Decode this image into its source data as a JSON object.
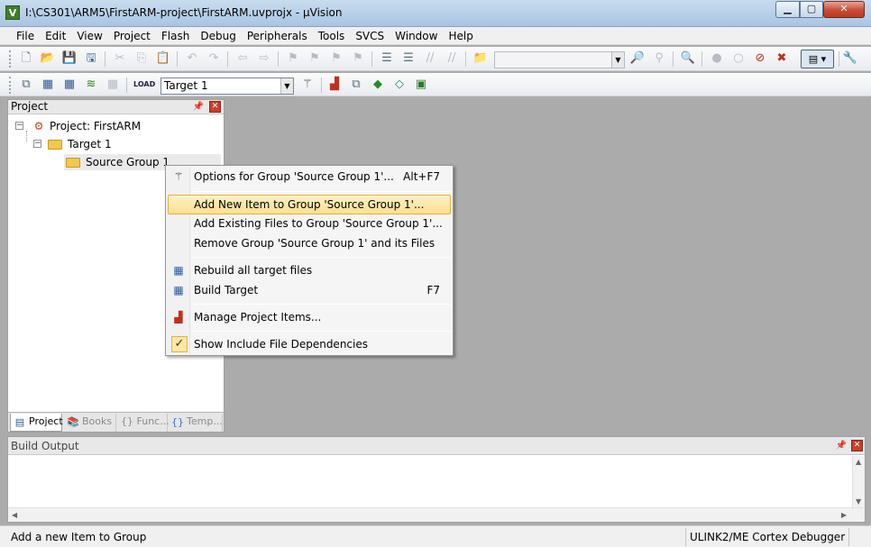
{
  "window": {
    "title": "I:\\CS301\\ARM5\\FirstARM-project\\FirstARM.uvprojx - µVision",
    "app_icon_letter": "V"
  },
  "menu": [
    "File",
    "Edit",
    "View",
    "Project",
    "Flash",
    "Debug",
    "Peripherals",
    "Tools",
    "SVCS",
    "Window",
    "Help"
  ],
  "toolbar2": {
    "target_select_value": "Target 1"
  },
  "project_panel": {
    "title": "Project",
    "tree": {
      "root_label": "Project: FirstARM",
      "target_label": "Target 1",
      "group_label": "Source Group 1"
    },
    "tabs": [
      {
        "label": "Project",
        "icon": "project-icon"
      },
      {
        "label": "Books",
        "icon": "books-icon"
      },
      {
        "label": "{} Func...",
        "icon": "functions-icon"
      },
      {
        "label": "Temp...",
        "icon": "templates-icon"
      }
    ]
  },
  "context_menu": {
    "items": [
      {
        "label": "Options for Group 'Source Group 1'...",
        "shortcut": "Alt+F7",
        "icon": "options-wand-icon"
      },
      {
        "label": "Add New  Item to Group 'Source Group 1'...",
        "shortcut": "",
        "icon": ""
      },
      {
        "label": "Add Existing Files to Group 'Source Group 1'...",
        "shortcut": "",
        "icon": ""
      },
      {
        "label": "Remove Group 'Source Group 1' and its Files",
        "shortcut": "",
        "icon": ""
      },
      {
        "label": "Rebuild all target files",
        "shortcut": "",
        "icon": "rebuild-icon"
      },
      {
        "label": "Build Target",
        "shortcut": "F7",
        "icon": "build-icon"
      },
      {
        "label": "Manage Project Items...",
        "shortcut": "",
        "icon": "manage-items-icon"
      },
      {
        "label": "Show Include File Dependencies",
        "shortcut": "",
        "icon": "checkmark-icon"
      }
    ],
    "highlighted_index": 1
  },
  "build_output": {
    "title": "Build Output"
  },
  "status_bar": {
    "message": "Add a new Item to Group",
    "debugger": "ULINK2/ME Cortex Debugger"
  }
}
